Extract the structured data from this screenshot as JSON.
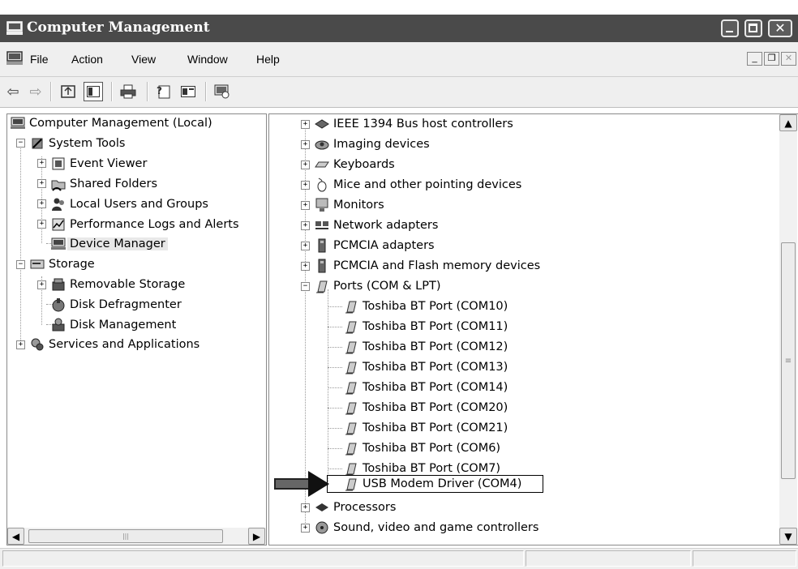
{
  "window": {
    "title": "Computer Management"
  },
  "menu": {
    "items": [
      "File",
      "Action",
      "View",
      "Window",
      "Help"
    ]
  },
  "left_tree": {
    "items": [
      {
        "label": "Computer Management (Local)",
        "icon": "computer-icon"
      },
      {
        "label": "System Tools",
        "icon": "tools-icon"
      },
      {
        "label": "Event Viewer",
        "icon": "event-viewer-icon"
      },
      {
        "label": "Shared Folders",
        "icon": "shared-folder-icon"
      },
      {
        "label": "Local Users and Groups",
        "icon": "users-icon"
      },
      {
        "label": "Performance Logs and Alerts",
        "icon": "performance-icon"
      },
      {
        "label": "Device Manager",
        "icon": "device-manager-icon"
      },
      {
        "label": "Storage",
        "icon": "storage-icon"
      },
      {
        "label": "Removable Storage",
        "icon": "removable-storage-icon"
      },
      {
        "label": "Disk Defragmenter",
        "icon": "defrag-icon"
      },
      {
        "label": "Disk Management",
        "icon": "disk-management-icon"
      },
      {
        "label": "Services and Applications",
        "icon": "services-icon"
      }
    ]
  },
  "right_tree": {
    "items": [
      {
        "label": "IEEE 1394 Bus host controllers",
        "icon": "ieee1394-icon"
      },
      {
        "label": "Imaging devices",
        "icon": "imaging-icon"
      },
      {
        "label": "Keyboards",
        "icon": "keyboard-icon"
      },
      {
        "label": "Mice and other pointing devices",
        "icon": "mouse-icon"
      },
      {
        "label": "Monitors",
        "icon": "monitor-icon"
      },
      {
        "label": "Network adapters",
        "icon": "network-icon"
      },
      {
        "label": "PCMCIA adapters",
        "icon": "pcmcia-icon"
      },
      {
        "label": "PCMCIA and Flash memory devices",
        "icon": "pcmcia-icon"
      },
      {
        "label": "Ports (COM & LPT)",
        "icon": "port-icon"
      },
      {
        "label": "Toshiba BT Port (COM10)",
        "icon": "port-icon"
      },
      {
        "label": "Toshiba BT Port (COM11)",
        "icon": "port-icon"
      },
      {
        "label": "Toshiba BT Port (COM12)",
        "icon": "port-icon"
      },
      {
        "label": "Toshiba BT Port (COM13)",
        "icon": "port-icon"
      },
      {
        "label": "Toshiba BT Port (COM14)",
        "icon": "port-icon"
      },
      {
        "label": "Toshiba BT Port (COM20)",
        "icon": "port-icon"
      },
      {
        "label": "Toshiba BT Port (COM21)",
        "icon": "port-icon"
      },
      {
        "label": "Toshiba BT Port (COM6)",
        "icon": "port-icon"
      },
      {
        "label": "Toshiba BT Port (COM7)",
        "icon": "port-icon"
      },
      {
        "label": "USB Modem Driver (COM4)",
        "icon": "port-icon"
      },
      {
        "label": "Processors",
        "icon": "processor-icon"
      },
      {
        "label": "Sound, video and game controllers",
        "icon": "sound-icon"
      }
    ]
  }
}
